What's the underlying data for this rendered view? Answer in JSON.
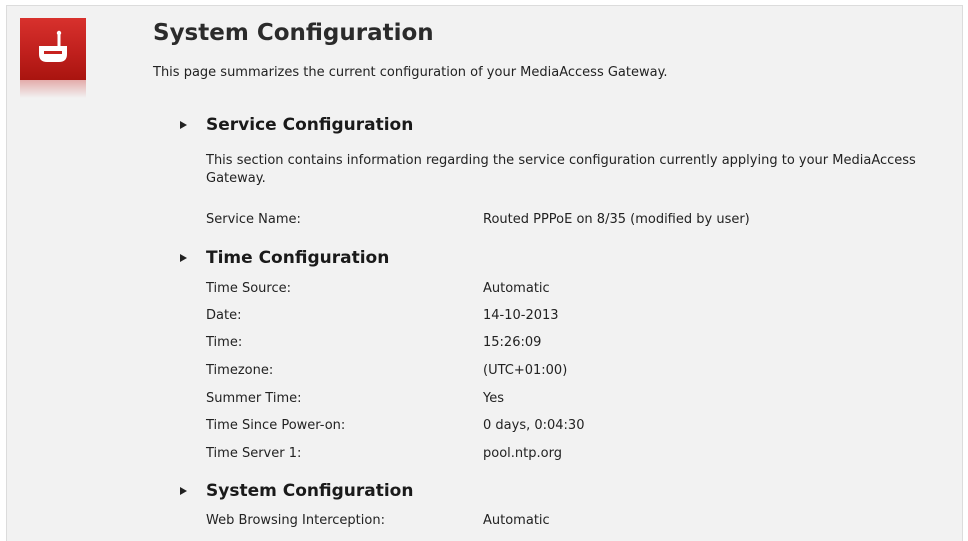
{
  "header": {
    "title": "System Configuration",
    "description": "This page summarizes the current configuration of your MediaAccess Gateway.",
    "logo_icon": "gateway-icon",
    "logo_color": "#c8221f"
  },
  "sections": {
    "service": {
      "title": "Service Configuration",
      "description": "This section contains information regarding the service configuration currently applying to your MediaAccess Gateway.",
      "rows": [
        {
          "label": "Service Name:",
          "value": "Routed PPPoE on 8/35 (modified by user)"
        }
      ]
    },
    "time": {
      "title": "Time Configuration",
      "rows": [
        {
          "label": "Time Source:",
          "value": "Automatic"
        },
        {
          "label": "Date:",
          "value": "14-10-2013"
        },
        {
          "label": "Time:",
          "value": "15:26:09"
        },
        {
          "label": "Timezone:",
          "value": "(UTC+01:00)"
        },
        {
          "label": "Summer Time:",
          "value": "Yes"
        },
        {
          "label": "Time Since Power-on:",
          "value": "0 days, 0:04:30"
        },
        {
          "label": "Time Server 1:",
          "value": "pool.ntp.org"
        }
      ]
    },
    "system": {
      "title": "System Configuration",
      "rows": [
        {
          "label": "Web Browsing Interception:",
          "value": "Automatic"
        }
      ]
    }
  }
}
